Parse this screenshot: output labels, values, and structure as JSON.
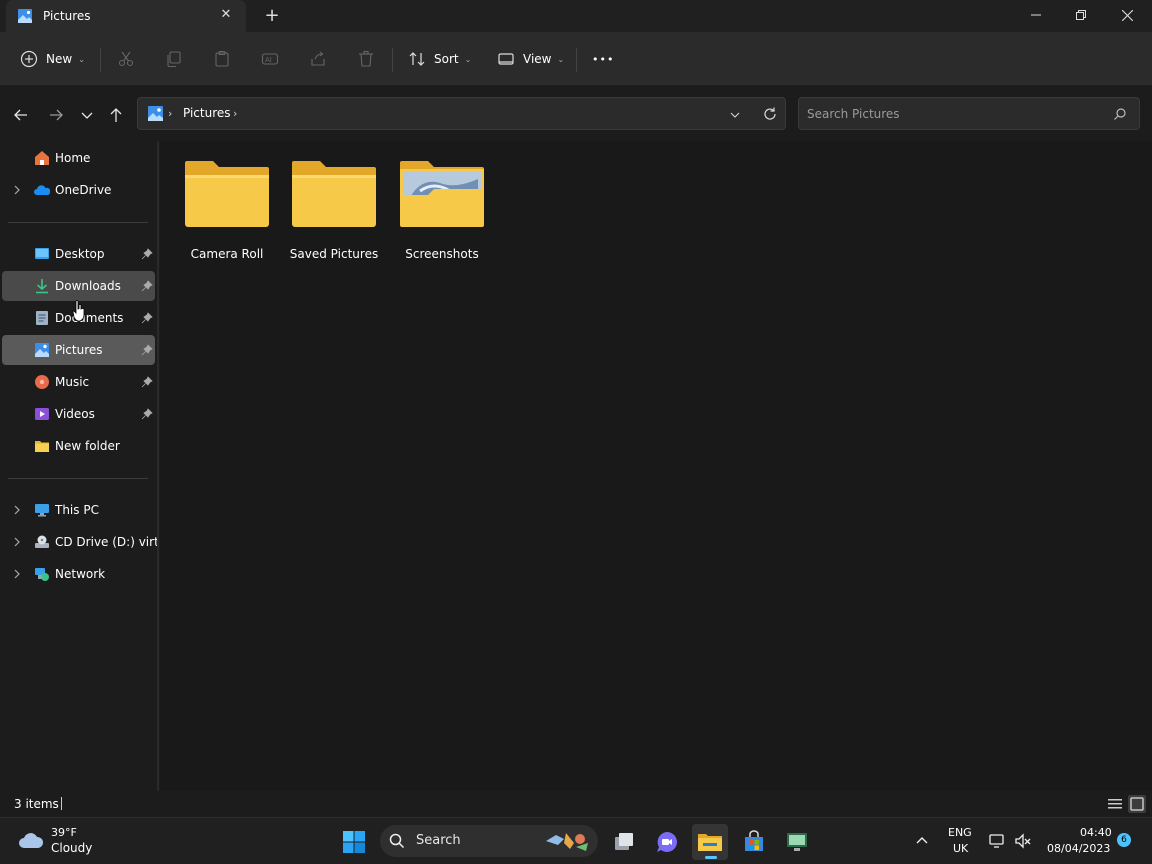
{
  "window": {
    "tab_title": "Pictures",
    "new_tab": "+"
  },
  "toolbar": {
    "new_label": "New",
    "sort_label": "Sort",
    "view_label": "View",
    "more_label": "•••"
  },
  "address": {
    "crumbs": [
      "Pictures"
    ]
  },
  "search": {
    "placeholder": "Search Pictures"
  },
  "sidebar": {
    "items": [
      {
        "label": "Home",
        "icon": "home-icon"
      },
      {
        "label": "OneDrive",
        "icon": "onedrive-icon"
      },
      {
        "label": "Desktop",
        "icon": "desktop-icon",
        "pinned": true
      },
      {
        "label": "Downloads",
        "icon": "downloads-icon",
        "pinned": true,
        "state": "hover"
      },
      {
        "label": "Documents",
        "icon": "documents-icon",
        "pinned": true
      },
      {
        "label": "Pictures",
        "icon": "pictures-icon",
        "pinned": true,
        "state": "selected"
      },
      {
        "label": "Music",
        "icon": "music-icon",
        "pinned": true
      },
      {
        "label": "Videos",
        "icon": "videos-icon",
        "pinned": true
      },
      {
        "label": "New folder",
        "icon": "folder-icon"
      },
      {
        "label": "This PC",
        "icon": "this-pc-icon"
      },
      {
        "label": "CD Drive (D:) virtio-",
        "icon": "cd-drive-icon"
      },
      {
        "label": "Network",
        "icon": "network-icon"
      }
    ]
  },
  "content": {
    "folders": [
      {
        "name": "Camera Roll"
      },
      {
        "name": "Saved Pictures"
      },
      {
        "name": "Screenshots"
      }
    ]
  },
  "status": {
    "item_count": "3 items"
  },
  "taskbar": {
    "weather_temp": "39°F",
    "weather_desc": "Cloudy",
    "search_label": "Search",
    "lang_line1": "ENG",
    "lang_line2": "UK",
    "time": "04:40",
    "date": "08/04/2023",
    "notification_count": "6"
  },
  "colors": {
    "folder_yellow": "#f7c948",
    "selection": "#5a5a5a",
    "accent": "#4cc2ff"
  }
}
